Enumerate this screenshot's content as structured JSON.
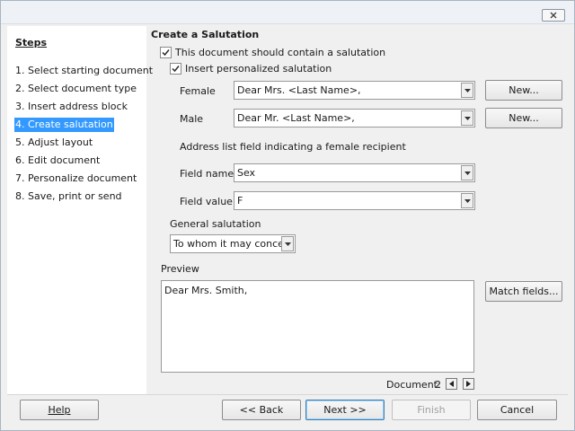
{
  "steps": {
    "title": "Steps",
    "items": [
      "1. Select starting document",
      "2. Select document type",
      "3. Insert address block",
      "4. Create salutation",
      "5. Adjust layout",
      "6. Edit document",
      "7. Personalize document",
      "8. Save, print or send"
    ],
    "active_index": 3
  },
  "main": {
    "title": "Create a Salutation",
    "contain_salutation": {
      "label": "This document should contain a salutation",
      "checked": true
    },
    "personalized": {
      "label": "Insert personalized salutation",
      "checked": true
    },
    "female": {
      "label": "Female",
      "value": "Dear Mrs. <Last Name>,",
      "button": "New..."
    },
    "male": {
      "label": "Male",
      "value": "Dear Mr. <Last Name>,",
      "button": "New..."
    },
    "address_field_label": "Address list field indicating a female recipient",
    "field_name": {
      "label": "Field name",
      "value": "Sex"
    },
    "field_value": {
      "label": "Field value",
      "value": "F"
    },
    "general": {
      "label": "General salutation",
      "value": "To whom it may concern,"
    },
    "preview": {
      "label": "Preview",
      "text": "Dear Mrs. Smith,",
      "match_button": "Match fields..."
    },
    "document": {
      "label": "Document:",
      "number": "2"
    }
  },
  "footer": {
    "help": "Help",
    "back": "<< Back",
    "next": "Next >>",
    "finish": "Finish",
    "cancel": "Cancel"
  },
  "colors": {
    "selection": "#3399ff",
    "panel": "#ffffff",
    "dialog": "#f0f0f0"
  }
}
